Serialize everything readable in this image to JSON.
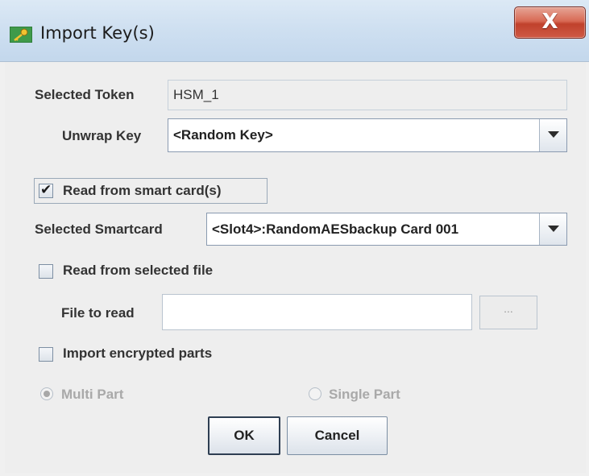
{
  "window": {
    "title": "Import Key(s)",
    "close_label": "X"
  },
  "selected_token": {
    "label": "Selected Token",
    "value": "HSM_1"
  },
  "unwrap_key": {
    "label": "Unwrap Key",
    "value": "<Random Key>"
  },
  "read_smart_card": {
    "label": "Read from smart card(s)",
    "checked": true,
    "check_glyph": "✔"
  },
  "selected_smartcard": {
    "label": "Selected Smartcard",
    "value": "<Slot4>:RandomAESbackup Card 001"
  },
  "read_file": {
    "label": "Read from selected file",
    "checked": false
  },
  "file_to_read": {
    "label": "File to read",
    "value": "",
    "browse_label": "..."
  },
  "import_encrypted": {
    "label": "Import encrypted parts",
    "checked": false
  },
  "radios": {
    "multi_part": "Multi Part",
    "single_part": "Single Part",
    "selected": "multi_part"
  },
  "buttons": {
    "ok": "OK",
    "cancel": "Cancel"
  },
  "colors": {
    "title_bar": "#cfe0f1",
    "close_button": "#c0412c",
    "background": "#eeeeee"
  }
}
